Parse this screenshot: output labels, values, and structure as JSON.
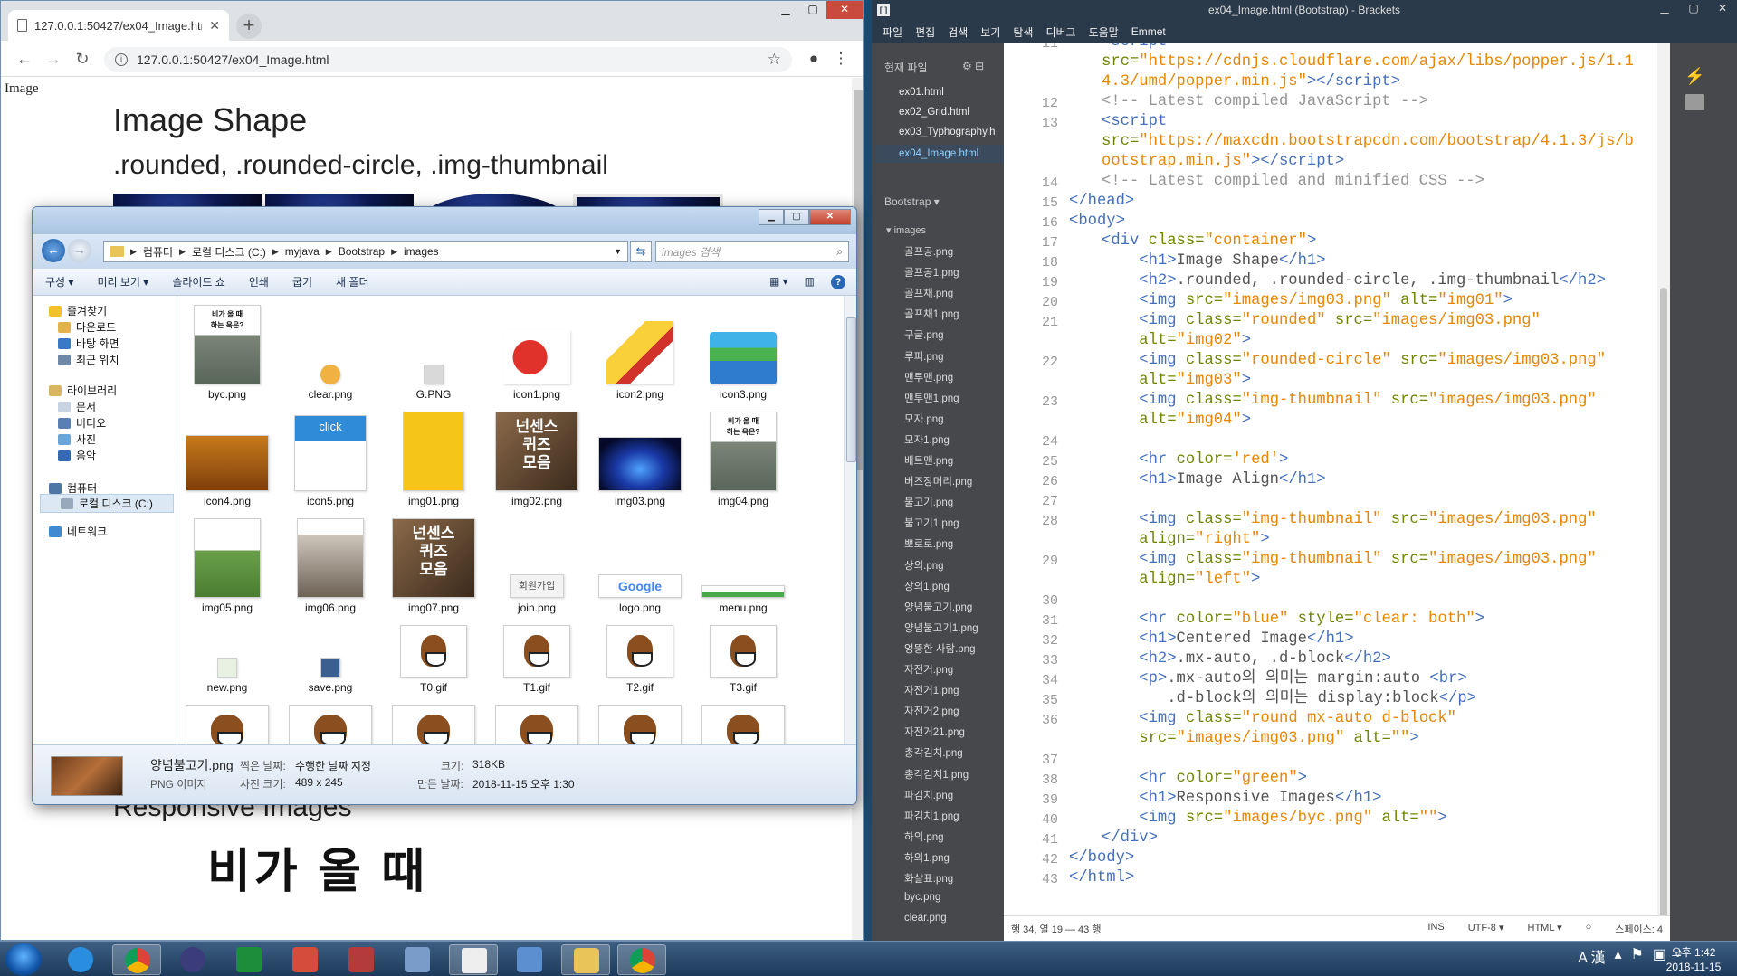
{
  "chrome": {
    "tab_title": "127.0.0.1:50427/ex04_Image.htm",
    "url": "127.0.0.1:50427/ex04_Image.html",
    "page": {
      "img_label": "Image",
      "h1": "Image Shape",
      "h2": ".rounded, .rounded-circle, .img-thumbnail",
      "bottom_h2": "Responsive Images",
      "byc_text": "비가 올 때"
    }
  },
  "explorer": {
    "breadcrumb": [
      "컴퓨터",
      "로컬 디스크 (C:)",
      "myjava",
      "Bootstrap",
      "images"
    ],
    "search_placeholder": "images 검색",
    "commands": [
      "구성 ▾",
      "미리 보기 ▾",
      "슬라이드 쇼",
      "인쇄",
      "굽기",
      "새 폴더"
    ],
    "nav": {
      "favorites": "즐겨찾기",
      "downloads": "다운로드",
      "desktop": "바탕 화면",
      "recent": "최근 위치",
      "libraries": "라이브러리",
      "documents": "문서",
      "videos": "비디오",
      "pictures": "사진",
      "music": "음악",
      "computer": "컴퓨터",
      "local_disk": "로컬 디스크 (C:)",
      "network": "네트워크"
    },
    "files": [
      {
        "name": "byc.png"
      },
      {
        "name": "clear.png"
      },
      {
        "name": "G.PNG"
      },
      {
        "name": "icon1.png"
      },
      {
        "name": "icon2.png"
      },
      {
        "name": "icon3.png"
      },
      {
        "name": "icon4.png"
      },
      {
        "name": "icon5.png"
      },
      {
        "name": "img01.png"
      },
      {
        "name": "img02.png"
      },
      {
        "name": "img03.png"
      },
      {
        "name": "img04.png"
      },
      {
        "name": "img05.png"
      },
      {
        "name": "img06.png"
      },
      {
        "name": "img07.png"
      },
      {
        "name": "join.png"
      },
      {
        "name": "logo.png"
      },
      {
        "name": "menu.png"
      },
      {
        "name": "new.png"
      },
      {
        "name": "save.png"
      },
      {
        "name": "T0.gif"
      },
      {
        "name": "T1.gif"
      },
      {
        "name": "T2.gif"
      },
      {
        "name": "T3.gif"
      }
    ],
    "thumb_text": {
      "byc": "비가 올 때\n하는 욕은?",
      "click": "click",
      "nonsense": "넌센스\n퀴즈\n모음",
      "join": "회원가입",
      "google": "Google"
    },
    "details": {
      "filename": "양념불고기.png",
      "type": "PNG 이미지",
      "date_taken_label": "찍은 날짜:",
      "date_taken": "수행한 날짜 지정",
      "dims_label": "사진 크기:",
      "dims": "489 x 245",
      "size_label": "크기:",
      "size": "318KB",
      "created_label": "만든 날짜:",
      "created": "2018-11-15 오후 1:30"
    }
  },
  "brackets": {
    "title": "ex04_Image.html (Bootstrap) - Brackets",
    "menu": [
      "파일",
      "편집",
      "검색",
      "보기",
      "탐색",
      "디버그",
      "도움말",
      "Emmet"
    ],
    "working_files_header": "현재 파일",
    "working_files": [
      "ex01.html",
      "ex02_Grid.html",
      "ex03_Typhography.h",
      "ex04_Image.html"
    ],
    "project": "Bootstrap ▾",
    "folder": "images",
    "tree": [
      "골프공.png",
      "골프공1.png",
      "골프채.png",
      "골프채1.png",
      "구글.png",
      "루피.png",
      "맨투맨.png",
      "맨투맨1.png",
      "모자.png",
      "모자1.png",
      "배트맨.png",
      "버즈장머리.png",
      "불고기.png",
      "불고기1.png",
      "뽀로로.png",
      "상의.png",
      "상의1.png",
      "양념불고기.png",
      "양념불고기1.png",
      "엉뚱한 사람.png",
      "자전거.png",
      "자전거1.png",
      "자전거2.png",
      "자전거21.png",
      "총각김치.png",
      "총각김치1.png",
      "파김치.png",
      "파김치1.png",
      "하의.png",
      "하의1.png",
      "화살표.png",
      "byc.png",
      "clear.png"
    ],
    "status": {
      "position": "행 34, 열 19 — 43 행",
      "ins": "INS",
      "encoding": "UTF-8 ▾",
      "lang": "HTML ▾",
      "spaces": "스페이스: 4"
    }
  },
  "taskbar": {
    "time": "오후 1:42",
    "date": "2018-11-15",
    "ime": "A 漢"
  }
}
